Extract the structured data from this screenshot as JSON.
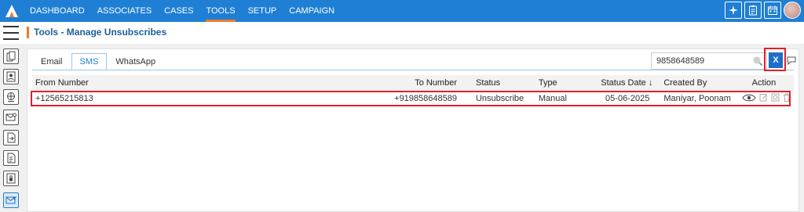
{
  "nav": {
    "items": [
      {
        "label": "DASHBOARD",
        "active": false
      },
      {
        "label": "ASSOCIATES",
        "active": false
      },
      {
        "label": "CASES",
        "active": false
      },
      {
        "label": "TOOLS",
        "active": true
      },
      {
        "label": "SETUP",
        "active": false
      },
      {
        "label": "CAMPAIGN",
        "active": false
      }
    ],
    "right_icons": [
      "sparkle-icon",
      "clipboard-icon",
      "calendar-icon"
    ]
  },
  "page": {
    "title": "Tools - Manage Unsubscribes"
  },
  "sidebar": {
    "icons": [
      "copy-icon",
      "contact-card-icon",
      "globe-icon",
      "mail-settings-icon",
      "document-arrow-icon",
      "document-export-icon",
      "lock-document-icon",
      "mail-check-icon"
    ]
  },
  "tabs": [
    {
      "label": "Email",
      "active": false
    },
    {
      "label": "SMS",
      "active": true
    },
    {
      "label": "WhatsApp",
      "active": false
    }
  ],
  "search": {
    "value": "9858648589",
    "clear_label": "X"
  },
  "table": {
    "columns": {
      "from": "From Number",
      "to": "To Number",
      "status": "Status",
      "type": "Type",
      "date": "Status Date",
      "created": "Created By",
      "action": "Action"
    },
    "sort_indicator": "↓",
    "rows": [
      {
        "from": "+12565215813",
        "to": "+919858648589",
        "status": "Unsubscribe",
        "type": "Manual",
        "date": "05-06-2025",
        "created": "Maniyar, Poonam"
      }
    ]
  },
  "colors": {
    "nav": "#1f7fd4",
    "accent": "#f07a2a",
    "highlight": "#e0202a"
  }
}
